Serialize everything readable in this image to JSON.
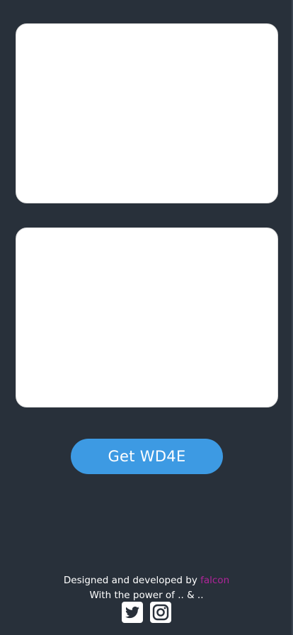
{
  "cards": [
    {
      "id": "card-1"
    },
    {
      "id": "card-2"
    }
  ],
  "cta": {
    "label": "Get WD4E"
  },
  "footer": {
    "credit_prefix": "Designed and developed by ",
    "author": "falcon",
    "power_line": "With the power of .. & .."
  },
  "social": [
    {
      "icon": "twitter-icon"
    },
    {
      "icon": "instagram-icon"
    }
  ],
  "colors": {
    "background": "#28303a",
    "card": "#ffffff",
    "button": "#3d9ae3",
    "author_link": "#b0239a",
    "text": "#ffffff"
  }
}
